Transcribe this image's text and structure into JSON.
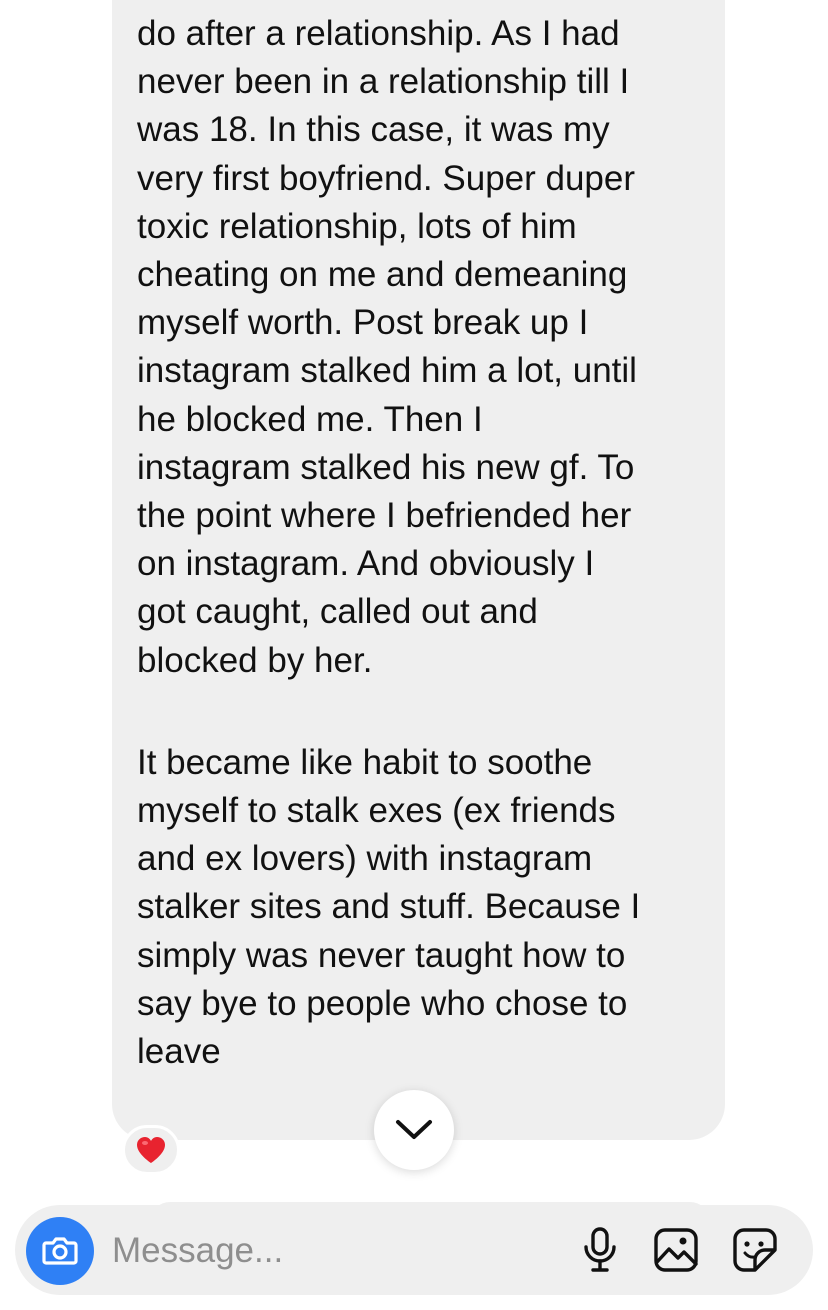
{
  "message": {
    "paragraph_1": "do after a relationship. As I had\nnever been in a relationship till I\nwas 18. In this case, it was my\nvery first boyfriend. Super duper\ntoxic relationship, lots of him\ncheating on me and demeaning\nmyself worth. Post break up I\ninstagram stalked him a lot, until\nhe blocked me. Then I\ninstagram stalked his new gf. To\nthe point where I befriended her\non instagram. And obviously I\ngot caught, called out and\nblocked by her.",
    "paragraph_2": "It became like habit to soothe\nmyself to stalk exes (ex friends\nand ex lovers) with instagram\nstalker sites and stuff. Because I\nsimply was never taught how to\nsay bye to people who chose to\nleave",
    "reaction": "❤️"
  },
  "composer": {
    "placeholder": "Message...",
    "value": ""
  },
  "icons": {
    "camera": "camera-icon",
    "scroll_down": "chevron-down-icon",
    "microphone": "microphone-icon",
    "gallery": "image-icon",
    "sticker": "sticker-icon"
  },
  "colors": {
    "bubble_bg": "#efefef",
    "camera_button": "#2f80f5",
    "text": "#111111",
    "placeholder": "#8e8e8e"
  }
}
